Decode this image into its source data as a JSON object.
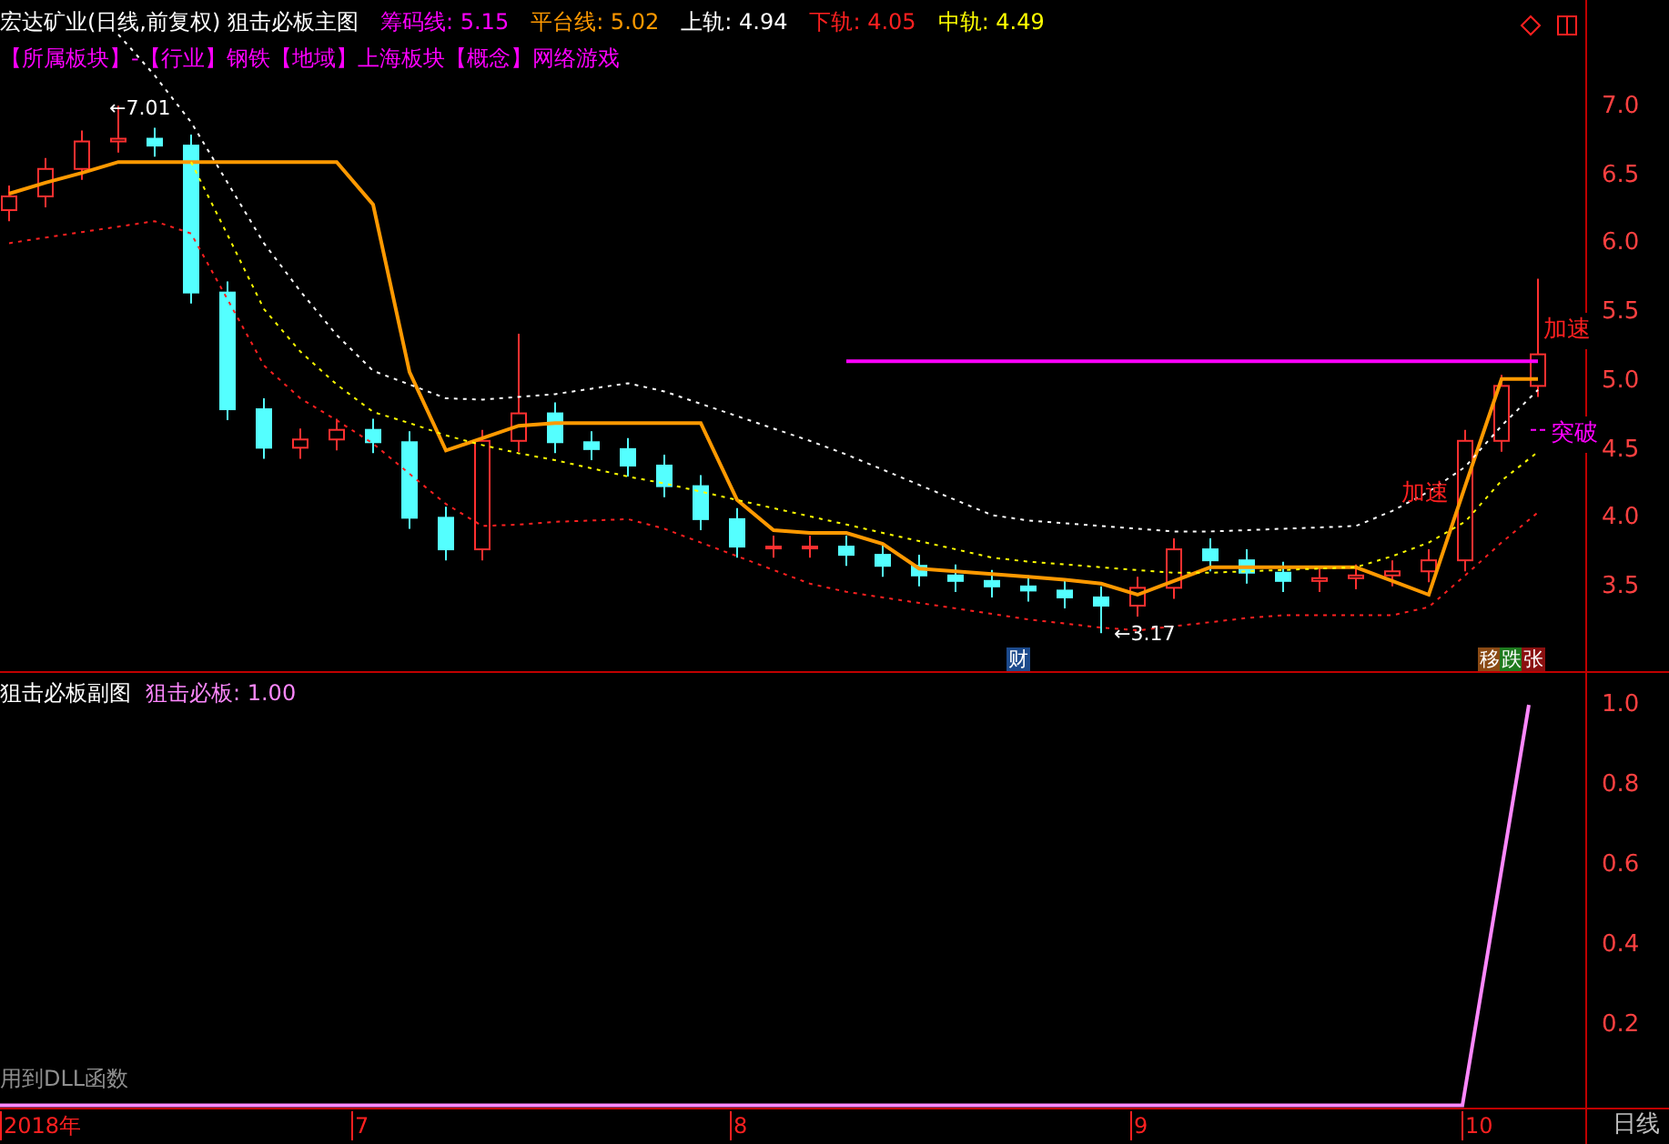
{
  "header": {
    "title": "宏达矿业(日线,前复权) 狙击必板主图"
  },
  "sector_line": "【所属板块】-【行业】钢铁【地域】上海板块【概念】网络游戏",
  "main_chart": {
    "annotations": [
      {
        "kind": "price",
        "text": "←7.01"
      },
      {
        "kind": "price",
        "text": "←3.17"
      },
      {
        "kind": "signal",
        "text": "加速"
      },
      {
        "kind": "signal",
        "text": "加速"
      },
      {
        "kind": "breakout",
        "text": "突破"
      }
    ],
    "legend_readings": [
      ": 5.15",
      ": 5.02",
      ": 4.94",
      ": 4.05",
      ": 4.49"
    ],
    "badges": [
      {
        "text": "财",
        "color": "#1c4a8c"
      },
      {
        "text": "移",
        "color": "#8a4a14"
      },
      {
        "text": "跌",
        "color": "#1e7a1e"
      },
      {
        "text": "张",
        "color": "#8a1010"
      }
    ],
    "chart_data": {
      "type": "candlestick",
      "categories": [
        null,
        null,
        null,
        null,
        null,
        null,
        null,
        null,
        null,
        null,
        null,
        null,
        null,
        null,
        null,
        null,
        null,
        null,
        null,
        null,
        null,
        null,
        null,
        null,
        null,
        null,
        null,
        null,
        null,
        null,
        null,
        null,
        null,
        null,
        null,
        null,
        null,
        null,
        null,
        null,
        null,
        null,
        null
      ],
      "ohlc": [
        [
          6.25,
          6.43,
          6.17,
          6.35
        ],
        [
          6.35,
          6.63,
          6.27,
          6.55
        ],
        [
          6.55,
          6.83,
          6.47,
          6.75
        ],
        [
          6.75,
          7.01,
          6.67,
          6.77
        ],
        [
          6.77,
          6.85,
          6.64,
          6.72
        ],
        [
          6.72,
          6.8,
          5.57,
          5.65
        ],
        [
          5.65,
          5.73,
          4.72,
          4.8
        ],
        [
          4.8,
          4.88,
          4.44,
          4.52
        ],
        [
          4.52,
          4.66,
          4.44,
          4.58
        ],
        [
          4.58,
          4.73,
          4.5,
          4.65
        ],
        [
          4.65,
          4.73,
          4.48,
          4.56
        ],
        [
          4.56,
          4.64,
          3.93,
          4.01
        ],
        [
          4.01,
          4.09,
          3.7,
          3.78
        ],
        [
          3.78,
          4.65,
          3.7,
          4.57
        ],
        [
          4.57,
          5.35,
          4.49,
          4.77
        ],
        [
          4.77,
          4.85,
          4.48,
          4.56
        ],
        [
          4.56,
          4.64,
          4.43,
          4.51
        ],
        [
          4.51,
          4.59,
          4.31,
          4.39
        ],
        [
          4.39,
          4.47,
          4.16,
          4.24
        ],
        [
          4.24,
          4.32,
          3.92,
          4.0
        ],
        [
          4.0,
          4.08,
          3.72,
          3.8
        ],
        [
          3.8,
          3.88,
          3.72,
          3.8
        ],
        [
          3.8,
          3.88,
          3.72,
          3.8
        ],
        [
          3.8,
          3.88,
          3.66,
          3.74
        ],
        [
          3.74,
          3.82,
          3.58,
          3.66
        ],
        [
          3.66,
          3.74,
          3.51,
          3.59
        ],
        [
          3.59,
          3.67,
          3.47,
          3.55
        ],
        [
          3.55,
          3.63,
          3.43,
          3.51
        ],
        [
          3.51,
          3.59,
          3.4,
          3.48
        ],
        [
          3.48,
          3.56,
          3.35,
          3.43
        ],
        [
          3.43,
          3.51,
          3.17,
          3.37
        ],
        [
          3.37,
          3.58,
          3.29,
          3.5
        ],
        [
          3.5,
          3.86,
          3.42,
          3.78
        ],
        [
          3.78,
          3.86,
          3.62,
          3.7
        ],
        [
          3.7,
          3.78,
          3.53,
          3.61
        ],
        [
          3.61,
          3.69,
          3.47,
          3.55
        ],
        [
          3.55,
          3.65,
          3.47,
          3.57
        ],
        [
          3.57,
          3.67,
          3.49,
          3.59
        ],
        [
          3.59,
          3.7,
          3.51,
          3.62
        ],
        [
          3.62,
          3.78,
          3.54,
          3.7
        ],
        [
          3.7,
          4.65,
          3.62,
          4.57
        ],
        [
          4.57,
          5.05,
          4.49,
          4.97
        ],
        [
          4.97,
          5.75,
          4.89,
          5.2
        ]
      ],
      "series": [
        {
          "name": "筹码线",
          "type": "line",
          "color": "#ff00ff",
          "line_style": "solid",
          "values": [
            null,
            null,
            null,
            null,
            null,
            null,
            null,
            null,
            null,
            null,
            null,
            null,
            null,
            null,
            null,
            null,
            null,
            null,
            null,
            null,
            null,
            null,
            null,
            5.15,
            5.15,
            5.15,
            5.15,
            5.15,
            5.15,
            5.15,
            5.15,
            5.15,
            5.15,
            5.15,
            5.15,
            5.15,
            5.15,
            5.15,
            5.15,
            5.15,
            5.15,
            5.15,
            5.15
          ]
        },
        {
          "name": "平台线",
          "type": "line",
          "color": "#ff9900",
          "line_style": "solid",
          "values": [
            6.37,
            6.45,
            6.52,
            6.6,
            6.6,
            6.6,
            6.6,
            6.6,
            6.6,
            6.6,
            6.29,
            5.07,
            4.5,
            4.59,
            4.68,
            4.7,
            4.7,
            4.7,
            4.7,
            4.7,
            4.14,
            3.92,
            3.9,
            3.9,
            3.82,
            3.64,
            3.62,
            3.6,
            3.58,
            3.56,
            3.53,
            3.45,
            3.55,
            3.65,
            3.65,
            3.65,
            3.65,
            3.65,
            3.55,
            3.45,
            4.24,
            5.02,
            5.02
          ]
        },
        {
          "name": "上轨",
          "type": "line",
          "color": "#ffffff",
          "line_style": "dashed",
          "values": [
            null,
            null,
            null,
            7.53,
            7.23,
            6.89,
            6.45,
            6.01,
            5.66,
            5.34,
            5.08,
            4.98,
            4.88,
            4.87,
            4.89,
            4.91,
            4.95,
            4.99,
            4.93,
            4.84,
            4.75,
            4.66,
            4.57,
            4.47,
            4.36,
            4.25,
            4.14,
            4.03,
            3.99,
            3.97,
            3.95,
            3.93,
            3.91,
            3.91,
            3.92,
            3.93,
            3.94,
            3.95,
            4.06,
            4.2,
            4.38,
            4.68,
            4.94
          ]
        },
        {
          "name": "下轨",
          "type": "line",
          "color": "#ff2020",
          "line_style": "dashed",
          "values": [
            6.01,
            6.05,
            6.09,
            6.13,
            6.17,
            6.08,
            5.6,
            5.12,
            4.88,
            4.72,
            4.55,
            4.33,
            4.11,
            3.95,
            3.96,
            3.98,
            3.99,
            4.0,
            3.93,
            3.83,
            3.73,
            3.63,
            3.53,
            3.47,
            3.43,
            3.39,
            3.35,
            3.31,
            3.27,
            3.24,
            3.21,
            3.19,
            3.22,
            3.25,
            3.28,
            3.3,
            3.3,
            3.3,
            3.3,
            3.36,
            3.59,
            3.83,
            4.05
          ]
        },
        {
          "name": "中轨",
          "type": "line",
          "color": "#ffff00",
          "line_style": "dashed",
          "values": [
            null,
            null,
            null,
            null,
            null,
            6.6,
            6.07,
            5.53,
            5.22,
            4.98,
            4.78,
            4.7,
            4.61,
            4.54,
            4.48,
            4.43,
            4.37,
            4.31,
            4.26,
            4.2,
            4.14,
            4.08,
            4.02,
            3.96,
            3.9,
            3.84,
            3.78,
            3.72,
            3.69,
            3.67,
            3.65,
            3.63,
            3.61,
            3.61,
            3.62,
            3.63,
            3.64,
            3.65,
            3.73,
            3.83,
            3.98,
            4.28,
            4.49
          ]
        }
      ],
      "ylim": [
        2.88,
        7.78
      ],
      "yticks": [
        {
          "value": 7,
          "label": "7.0"
        },
        {
          "value": 6.5,
          "label": "6.5"
        },
        {
          "value": 6,
          "label": "6.0"
        },
        {
          "value": 5.5,
          "label": "5.5"
        },
        {
          "value": 5,
          "label": "5.0"
        },
        {
          "value": 4.5,
          "label": "4.5"
        },
        {
          "value": 4,
          "label": "4.0"
        },
        {
          "value": 3.5,
          "label": "3.5"
        }
      ]
    }
  },
  "sub_chart": {
    "title": "狙击必板副图",
    "note": "用到DLL函数",
    "legend_readings": [
      ": 1.00"
    ],
    "chart_data": {
      "type": "line",
      "categories": [
        null,
        null,
        null,
        null,
        null,
        null,
        null,
        null,
        null,
        null,
        null,
        null,
        null,
        null,
        null,
        null,
        null,
        null,
        null,
        null,
        null,
        null,
        null,
        null
      ],
      "series": [
        {
          "name": "狙击必板",
          "color": "#ff88ff",
          "line_style": "solid",
          "values": [
            0,
            0,
            0,
            0,
            0,
            0,
            0,
            0,
            0,
            0,
            0,
            0,
            0,
            0,
            0,
            0,
            0,
            0,
            0,
            0,
            0,
            0,
            0,
            1
          ]
        }
      ],
      "ylim": [
        -0.01,
        1.08
      ],
      "yticks": [
        {
          "value": 1,
          "label": "1.0"
        },
        {
          "value": 0.8,
          "label": "0.8"
        },
        {
          "value": 0.6,
          "label": "0.6"
        },
        {
          "value": 0.4,
          "label": "0.4"
        },
        {
          "value": 0.2,
          "label": "0.2"
        }
      ]
    }
  },
  "time_axis": [
    "2018年",
    "7",
    "8",
    "9",
    "10"
  ],
  "period": "日线"
}
